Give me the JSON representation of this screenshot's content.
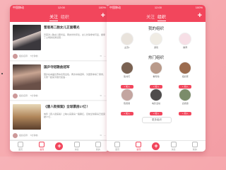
{
  "status_bar": {
    "carrier": "中国移动",
    "time": "12:00",
    "battery": "100%"
  },
  "left_phone": {
    "nav": {
      "tab_follow": "关注",
      "tab_org": "组织",
      "plus": "+"
    },
    "posts": [
      {
        "title": "普思再二胎女儿正面曝光",
        "text": "普思对二胎女儿曝光后，网友纷纷评论，女儿长得非常可爱，继承了父母的优秀基因...",
        "author": "组织名称",
        "time": "5分钟前",
        "img_color": "#3c3a3f"
      },
      {
        "title": "国乒夺冠歌曲冠军",
        "text": "国乒在本届比赛中表现出色，再次夺得冠军，为国家争得了荣誉，大家一起来为他们加油...",
        "author": "组织名称",
        "time": "5分钟前",
        "img_color": "#6a5048"
      },
      {
        "title": "《唐人街探案》全球票房17亿！",
        "text": "电影《唐人街探案》上映以来票房一路飘红，目前全球票房已经突破17亿...",
        "author": "组织名称",
        "time": "5分钟前",
        "img_color": "#b0865a"
      }
    ],
    "tabs": [
      "首页",
      "发现",
      "+",
      "消息",
      "我的"
    ]
  },
  "right_phone": {
    "nav": {
      "tab_follow": "关注",
      "tab_org": "组织",
      "plus": "+"
    },
    "my_orgs_title": "我的组织",
    "my_orgs": [
      {
        "name": "主页1",
        "color": "#e9e3dc"
      },
      {
        "name": "游戏",
        "color": "#f0ece4"
      },
      {
        "name": "推荐",
        "color": "#f7dfe6"
      }
    ],
    "hot_orgs_title": "热门组织",
    "hot_orgs": [
      {
        "name": "脸书们",
        "color": "#7a6252"
      },
      {
        "name": "看有他",
        "color": "#b99a8a"
      },
      {
        "name": "组织家",
        "color": "#9b6b4e"
      },
      {
        "name": "陈贤者",
        "color": "#c3a5a0"
      },
      {
        "name": "电影活动",
        "color": "#4f4c4c"
      },
      {
        "name": "去旅游",
        "color": "#7b8c6a"
      }
    ],
    "join_label": "+ 加入",
    "more_label": "更多组织",
    "tabs": [
      "首页",
      "发现",
      "+",
      "消息",
      "我的"
    ]
  }
}
